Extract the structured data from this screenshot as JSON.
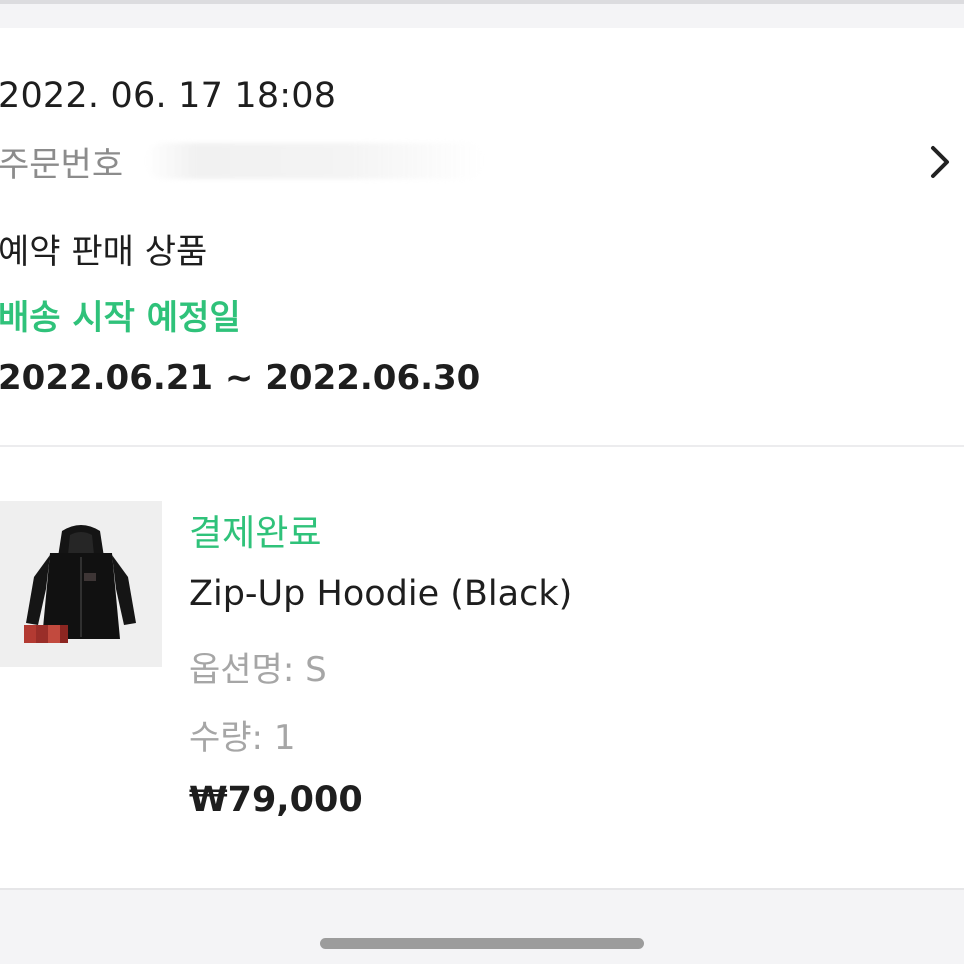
{
  "order": {
    "date": "2022. 06. 17 18:08",
    "number_label": "주문번호",
    "preorder_label": "예약 판매 상품",
    "shipping_title": "배송 시작 예정일",
    "shipping_range": "2022.06.21 ~ 2022.06.30",
    "detail_icon": "chevron-right-icon"
  },
  "product": {
    "status": "결제완료",
    "name": "Zip-Up Hoodie (Black)",
    "option": "옵션명: S",
    "quantity": "수량: 1",
    "price": "₩79,000",
    "status_color": "#2fc27a"
  },
  "colors": {
    "accent": "#2fc27a",
    "text": "#1e1e1e",
    "muted": "#a6a6a6",
    "background": "#f4f4f6"
  }
}
